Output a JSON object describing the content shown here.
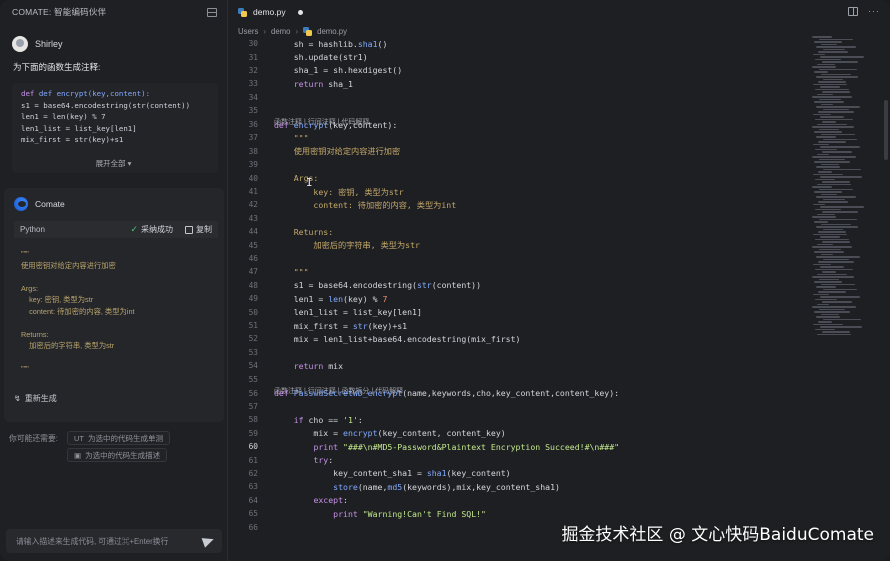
{
  "left_panel": {
    "title": "COMATE: 智能编码伙伴",
    "user_name": "Shirley",
    "prompt": "为下面的函数生成注释:",
    "code_lines": [
      "def encrypt(key,content):",
      "s1 = base64.encodestring(str(content))",
      "len1 = len(key) % 7",
      "len1_list = list_key[len1]",
      "mix_first = str(key)+s1"
    ],
    "expand_label": "展开全部",
    "bot_name": "Comate",
    "response_lang": "Python",
    "accept_label": "采纳成功",
    "copy_label": "复制",
    "response_lines": [
      "\"\"\"",
      "使用密钥对给定内容进行加密",
      "",
      "Args:",
      "    key: 密钥, 类型为str",
      "    content: 待加密的内容, 类型为int",
      "",
      "Returns:",
      "    加密后的字符串, 类型为str",
      "",
      "\"\"\""
    ],
    "regenerate_label": "重新生成",
    "suggest_label": "你可能还需要:",
    "suggestions": [
      "为选中的代码生成单测",
      "为选中的代码生成描述"
    ],
    "input_placeholder": "请输入描述来生成代码, 可通过⌘+Enter换行"
  },
  "editor": {
    "tab_name": "demo.py",
    "breadcrumb": [
      "Users",
      "demo",
      "demo.py"
    ],
    "active_line": 60,
    "code_lens_1": "函数注释 | 行间注释 | 代码解释",
    "code_lens_2": "函数注释 | 行间注释 | 函数拆分 | 代码解释",
    "lines": [
      {
        "no": 30,
        "text": "    sh = hashlib.sha1()"
      },
      {
        "no": 31,
        "text": "    sh.update(str1)"
      },
      {
        "no": 32,
        "text": "    sha_1 = sh.hexdigest()"
      },
      {
        "no": 33,
        "text": "    return sha_1"
      },
      {
        "no": 34,
        "text": ""
      },
      {
        "no": 35,
        "text": ""
      },
      {
        "no": 36,
        "text": "def encrypt(key,content):"
      },
      {
        "no": 37,
        "text": "    \"\"\""
      },
      {
        "no": 38,
        "text": "    使用密钥对给定内容进行加密"
      },
      {
        "no": 39,
        "text": ""
      },
      {
        "no": 40,
        "text": "    Args:"
      },
      {
        "no": 41,
        "text": "        key: 密钥, 类型为str"
      },
      {
        "no": 42,
        "text": "        content: 待加密的内容, 类型为int"
      },
      {
        "no": 43,
        "text": ""
      },
      {
        "no": 44,
        "text": "    Returns:"
      },
      {
        "no": 45,
        "text": "        加密后的字符串, 类型为str"
      },
      {
        "no": 46,
        "text": ""
      },
      {
        "no": 47,
        "text": "    \"\"\""
      },
      {
        "no": 48,
        "text": "    s1 = base64.encodestring(str(content))"
      },
      {
        "no": 49,
        "text": "    len1 = len(key) % 7"
      },
      {
        "no": 50,
        "text": "    len1_list = list_key[len1]"
      },
      {
        "no": 51,
        "text": "    mix_first = str(key)+s1"
      },
      {
        "no": 52,
        "text": "    mix = len1_list+base64.encodestring(mix_first)"
      },
      {
        "no": 53,
        "text": ""
      },
      {
        "no": 54,
        "text": "    return mix"
      },
      {
        "no": 55,
        "text": ""
      },
      {
        "no": 56,
        "text": "def PasswdSecretWD_encrypt(name,keywords,cho,key_content,content_key):"
      },
      {
        "no": 57,
        "text": ""
      },
      {
        "no": 58,
        "text": "    if cho == '1':"
      },
      {
        "no": 59,
        "text": "        mix = encrypt(key_content, content_key)"
      },
      {
        "no": 60,
        "text": "        print \"###\\n#MD5-Password&Plaintext Encryption Succeed!#\\n###\""
      },
      {
        "no": 61,
        "text": "        try:"
      },
      {
        "no": 62,
        "text": "            key_content_sha1 = sha1(key_content)"
      },
      {
        "no": 63,
        "text": "            store(name,md5(keywords),mix,key_content_sha1)"
      },
      {
        "no": 64,
        "text": "        except:"
      },
      {
        "no": 65,
        "text": "            print \"Warning!Can't Find SQL!\""
      },
      {
        "no": 66,
        "text": ""
      }
    ]
  },
  "watermark": "掘金技术社区 @ 文心快码BaiduComate",
  "colors": {
    "background": "#1e1f22",
    "keyword": "#c792ea",
    "function": "#82aaff",
    "string": "#c3e88d",
    "docstring": "#c4a96a",
    "accept_green": "#4fc27a"
  }
}
